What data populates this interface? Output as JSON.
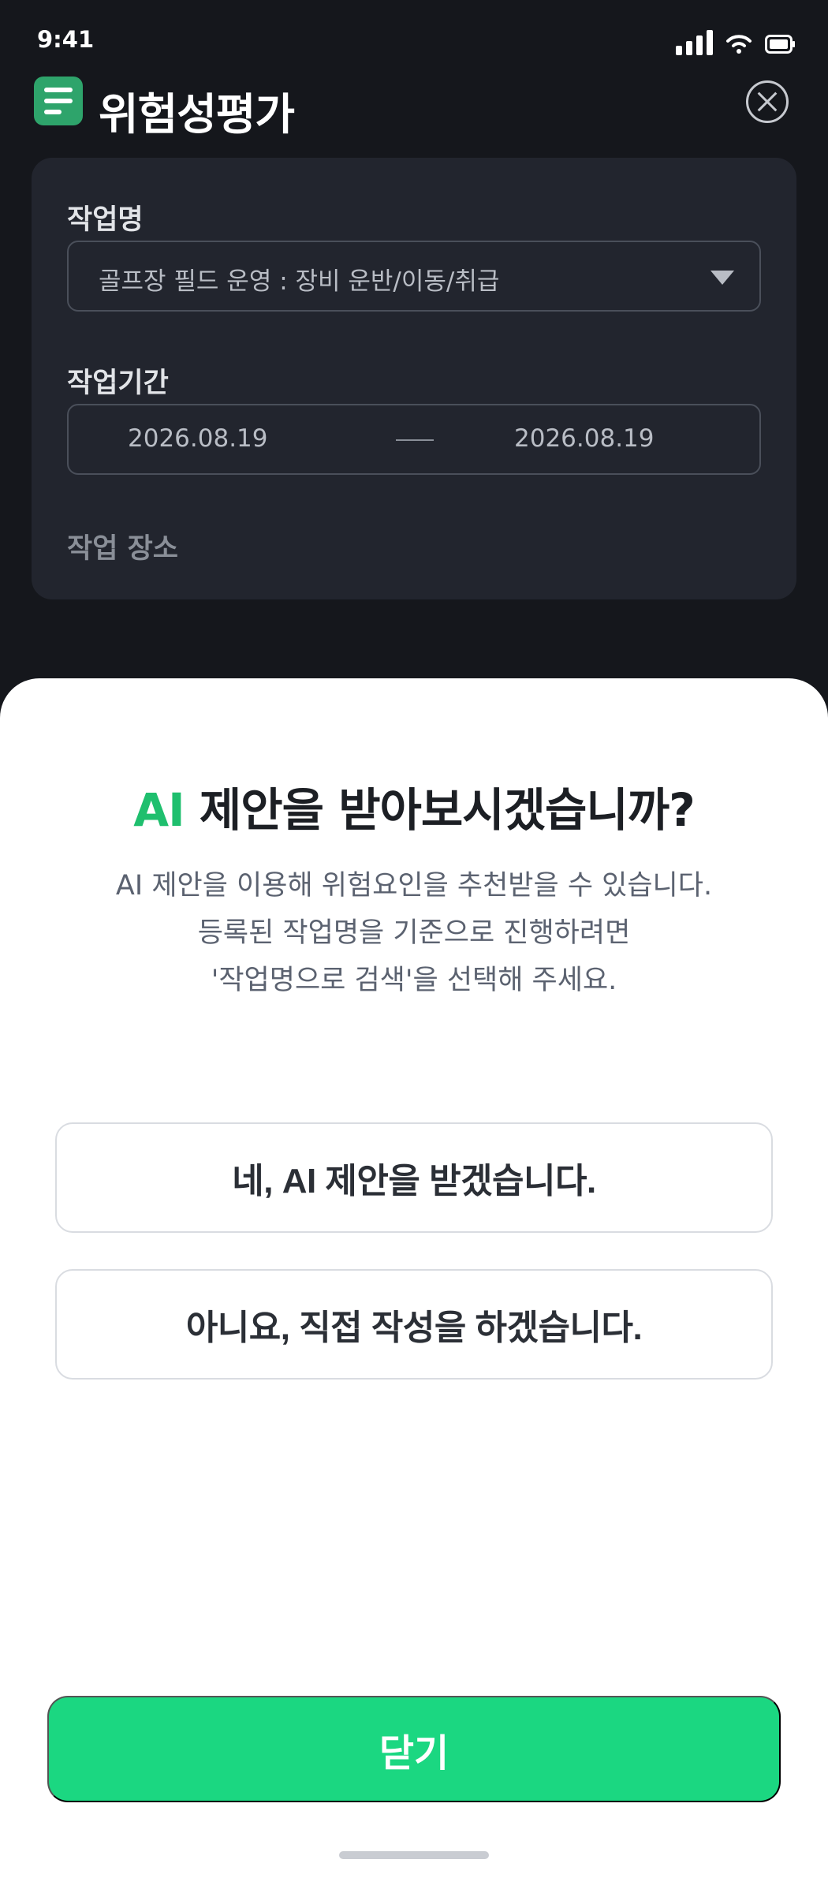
{
  "status_bar": {
    "time": "9:41"
  },
  "header": {
    "title": "위험성평가"
  },
  "form": {
    "task_name_label": "작업명",
    "task_name_value": "골프장 필드 운영 : 장비 운반/이동/취급",
    "period_label": "작업기간",
    "period_start": "2026.08.19",
    "period_end": "2026.08.19",
    "location_label": "작업 장소"
  },
  "sheet": {
    "title_accent": "AI",
    "title_rest": " 제안을 받아보시겠습니까?",
    "description": [
      "AI 제안을 이용해 위험요인을 추천받을 수 있습니다.",
      "등록된 작업명을 기준으로 진행하려면",
      "'작업명으로 검색'을 선택해 주세요."
    ],
    "option_yes": "네, AI 제안을 받겠습니다.",
    "option_no": "아니요, 직접 작성을 하겠습니다.",
    "close_label": "닫기"
  },
  "colors": {
    "accent": "#1fbf6e",
    "primary_button": "#1bd781",
    "doc_icon": "#2ea46b",
    "background": "#15171c"
  }
}
